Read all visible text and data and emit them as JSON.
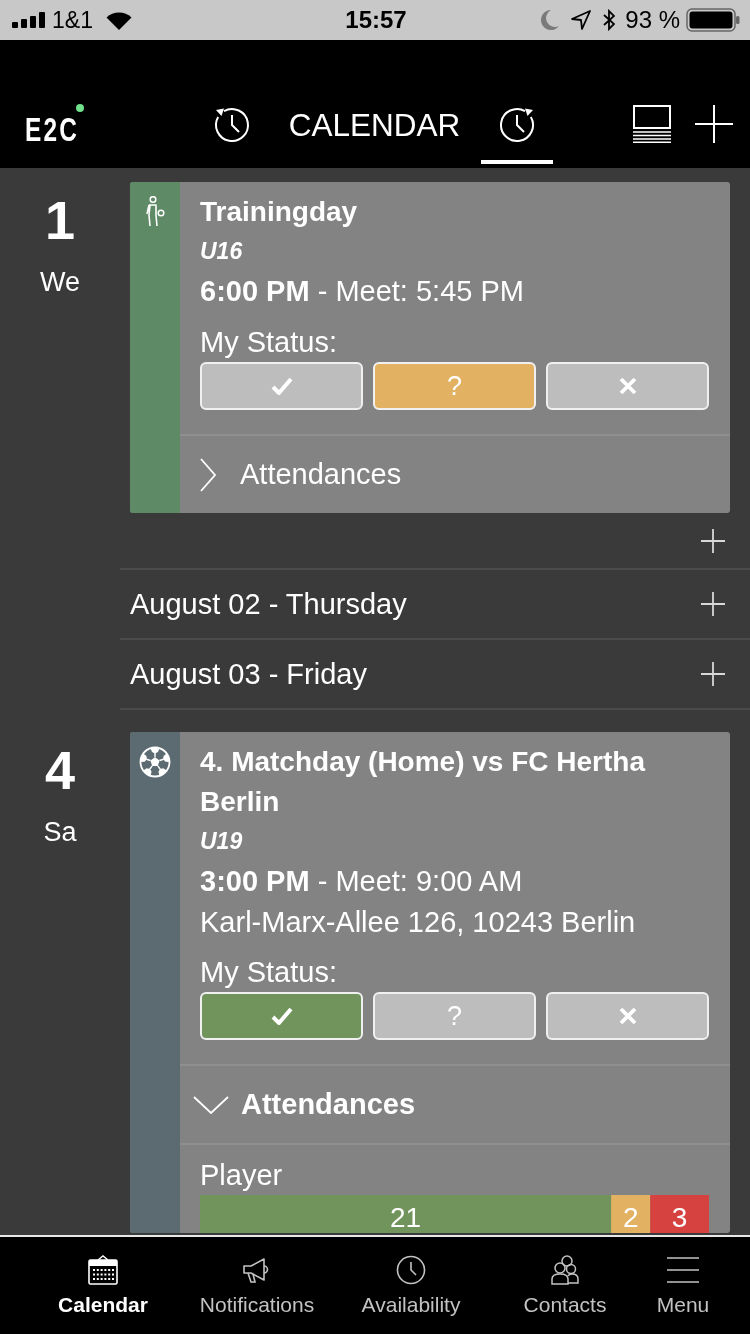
{
  "status_bar": {
    "carrier": "1&1",
    "time": "15:57",
    "battery": "93 %"
  },
  "header": {
    "logo": {
      "text": "E2C",
      "dot": true
    },
    "past_view": {
      "selected": false
    },
    "title": "CALENDAR",
    "upcoming_view": {
      "selected": true
    }
  },
  "agenda": [
    {
      "kind": "day",
      "number": "1",
      "weekday": "We",
      "events": [
        {
          "kind": "training",
          "color": "#5e8a66",
          "title": "Trainingday",
          "team": "U16",
          "time": "**6:00 PM** - Meet: 5:45 PM",
          "status_label": "My Status:",
          "status": [
            {
              "kind": "yes",
              "selected": false
            },
            {
              "kind": "maybe",
              "label": "?",
              "selected": true
            },
            {
              "kind": "no",
              "selected": false
            }
          ],
          "attendances": {
            "label": "Attendances",
            "expanded": false
          }
        }
      ],
      "add_row": true
    },
    {
      "kind": "empty",
      "label": "August 02 - Thursday"
    },
    {
      "kind": "empty",
      "label": "August 03 - Friday"
    },
    {
      "kind": "day",
      "number": "4",
      "weekday": "Sa",
      "events": [
        {
          "kind": "match",
          "color": "#5b6b71",
          "title": "4. Matchday (Home) vs FC Hertha Berlin",
          "team": "U19",
          "time": "**3:00 PM** - Meet: 9:00 AM",
          "location": "Karl-Marx-Allee 126, 10243 Berlin",
          "status_label": "My Status:",
          "status": [
            {
              "kind": "yes",
              "selected": true
            },
            {
              "kind": "maybe",
              "label": "?",
              "selected": false
            },
            {
              "kind": "no",
              "selected": false
            }
          ],
          "attendances": {
            "label": "Attendances",
            "expanded": true,
            "groups": [
              {
                "chart_data": {
                  "type": "bar",
                  "orientation": "horizontal",
                  "stacked": true,
                  "categories": [
                    "Player"
                  ],
                  "series": [
                    {
                      "color": "#71945d",
                      "values": [
                        21
                      ]
                    },
                    {
                      "color": "#e3b162",
                      "values": [
                        2
                      ]
                    },
                    {
                      "color": "#d6423f",
                      "values": [
                        3
                      ]
                    }
                  ],
                  "data_labels": true
                }
              }
            ]
          }
        }
      ]
    }
  ],
  "tab_bar": [
    {
      "kind": "calendar",
      "label": "Calendar",
      "selected": true
    },
    {
      "kind": "notifications",
      "label": "Notifications",
      "selected": false
    },
    {
      "kind": "availability",
      "label": "Availability",
      "selected": false
    },
    {
      "kind": "contacts",
      "label": "Contacts",
      "selected": false
    },
    {
      "kind": "menu",
      "label": "Menu",
      "selected": false
    }
  ]
}
